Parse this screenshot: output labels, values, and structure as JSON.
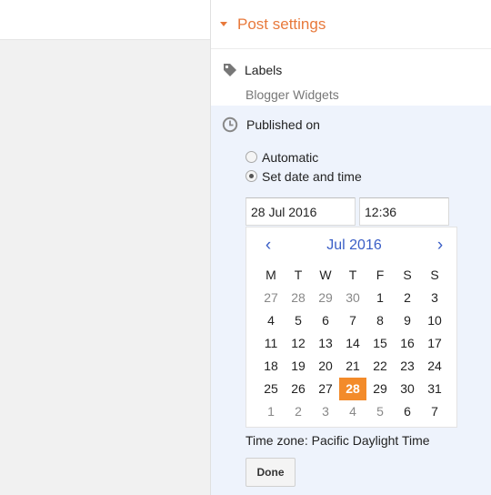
{
  "post_settings": {
    "title": "Post settings"
  },
  "labels": {
    "title": "Labels",
    "value": "Blogger Widgets"
  },
  "published": {
    "title": "Published on",
    "options": [
      {
        "label": "Automatic",
        "checked": false
      },
      {
        "label": "Set date and time",
        "checked": true
      }
    ],
    "date_value": "28 Jul 2016",
    "time_value": "12:36"
  },
  "calendar": {
    "prev": "‹",
    "next": "›",
    "month": "Jul 2016",
    "weekdays": [
      "M",
      "T",
      "W",
      "T",
      "F",
      "S",
      "S"
    ],
    "weeks": [
      [
        {
          "d": "27",
          "m": true
        },
        {
          "d": "28",
          "m": true
        },
        {
          "d": "29",
          "m": true
        },
        {
          "d": "30",
          "m": true
        },
        {
          "d": "1"
        },
        {
          "d": "2"
        },
        {
          "d": "3"
        }
      ],
      [
        {
          "d": "4"
        },
        {
          "d": "5"
        },
        {
          "d": "6"
        },
        {
          "d": "7"
        },
        {
          "d": "8"
        },
        {
          "d": "9"
        },
        {
          "d": "10"
        }
      ],
      [
        {
          "d": "11"
        },
        {
          "d": "12"
        },
        {
          "d": "13"
        },
        {
          "d": "14"
        },
        {
          "d": "15"
        },
        {
          "d": "16"
        },
        {
          "d": "17"
        }
      ],
      [
        {
          "d": "18"
        },
        {
          "d": "19"
        },
        {
          "d": "20"
        },
        {
          "d": "21"
        },
        {
          "d": "22"
        },
        {
          "d": "23"
        },
        {
          "d": "24"
        }
      ],
      [
        {
          "d": "25"
        },
        {
          "d": "26"
        },
        {
          "d": "27"
        },
        {
          "d": "28",
          "sel": true
        },
        {
          "d": "29"
        },
        {
          "d": "30"
        },
        {
          "d": "31"
        }
      ],
      [
        {
          "d": "1",
          "m": true
        },
        {
          "d": "2",
          "m": true
        },
        {
          "d": "3",
          "m": true
        },
        {
          "d": "4",
          "m": true
        },
        {
          "d": "5",
          "m": true
        },
        {
          "d": "6"
        },
        {
          "d": "7"
        }
      ]
    ]
  },
  "timezone": "Time zone: Pacific Daylight Time",
  "done_label": "Done",
  "colors": {
    "accent": "#e8793b",
    "selected_day": "#f38b2a",
    "link": "#3a5ec6",
    "panel_bg": "#eef3fc"
  }
}
